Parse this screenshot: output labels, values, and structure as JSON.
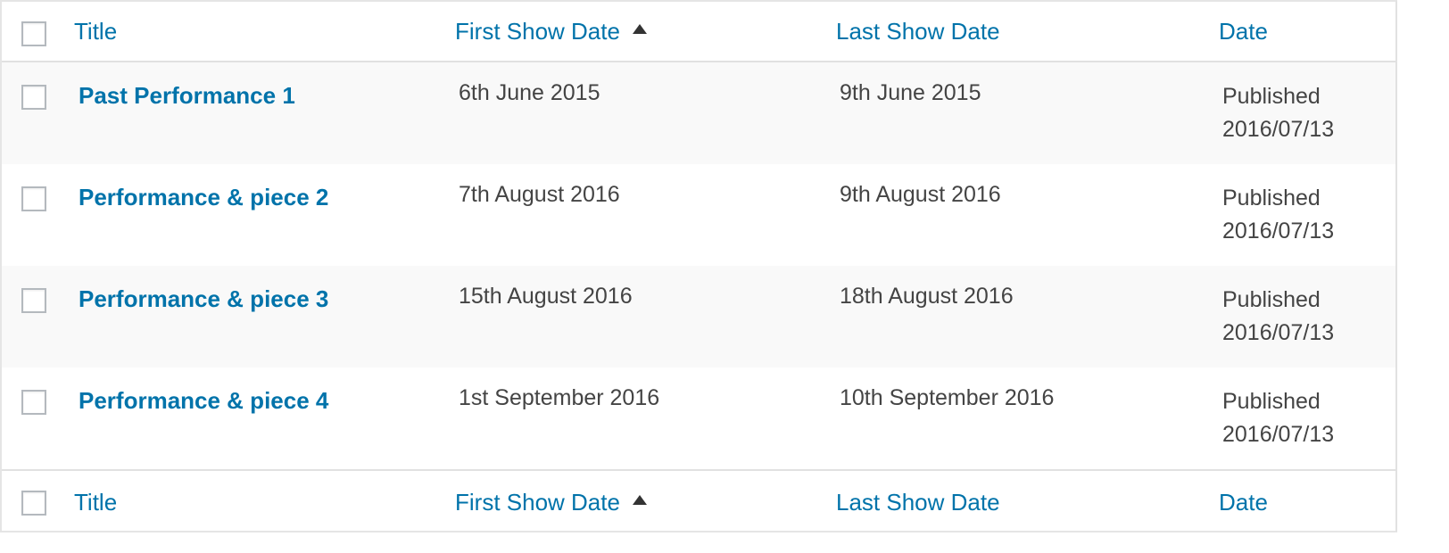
{
  "columns": {
    "title": "Title",
    "first_show_date": "First Show Date",
    "last_show_date": "Last Show Date",
    "date": "Date",
    "sort_indicator": "sort-ascending-icon"
  },
  "rows": [
    {
      "title": "Past Performance 1",
      "first": "6th June 2015",
      "last": "9th June 2015",
      "status": "Published",
      "date": "2016/07/13"
    },
    {
      "title": "Performance & piece 2",
      "first": "7th August 2016",
      "last": "9th August 2016",
      "status": "Published",
      "date": "2016/07/13"
    },
    {
      "title": "Performance & piece 3",
      "first": "15th August 2016",
      "last": "18th August 2016",
      "status": "Published",
      "date": "2016/07/13"
    },
    {
      "title": "Performance & piece 4",
      "first": "1st September 2016",
      "last": "10th September 2016",
      "status": "Published",
      "date": "2016/07/13"
    }
  ],
  "colors": {
    "link": "#0073aa",
    "text": "#444444",
    "alt_row": "#f9f9f9",
    "border": "#e1e1e1"
  }
}
